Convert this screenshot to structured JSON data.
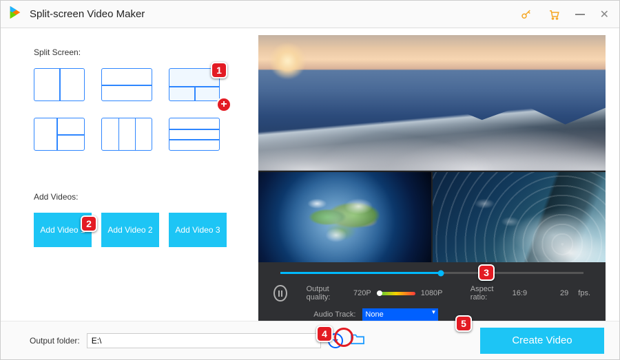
{
  "title": "Split-screen Video Maker",
  "left": {
    "split_screen_label": "Split Screen:",
    "add_videos_label": "Add Videos:",
    "add_buttons": [
      "Add Video 1",
      "Add Video 2",
      "Add Video 3"
    ]
  },
  "controls": {
    "progress_pct": 53,
    "output_quality_label": "Output quality:",
    "q_low": "720P",
    "q_high": "1080P",
    "aspect_label": "Aspect ratio:",
    "aspect_value": "16:9",
    "fps_value": "29",
    "fps_unit": "fps.",
    "audio_label": "Audio Track:",
    "audio_value": "None"
  },
  "footer": {
    "folder_label": "Output folder:",
    "folder_value": "E:\\",
    "create_label": "Create Video"
  },
  "callouts": {
    "c1": "1",
    "c2": "2",
    "c3": "3",
    "c4": "4",
    "c5": "5",
    "plus": "+"
  }
}
